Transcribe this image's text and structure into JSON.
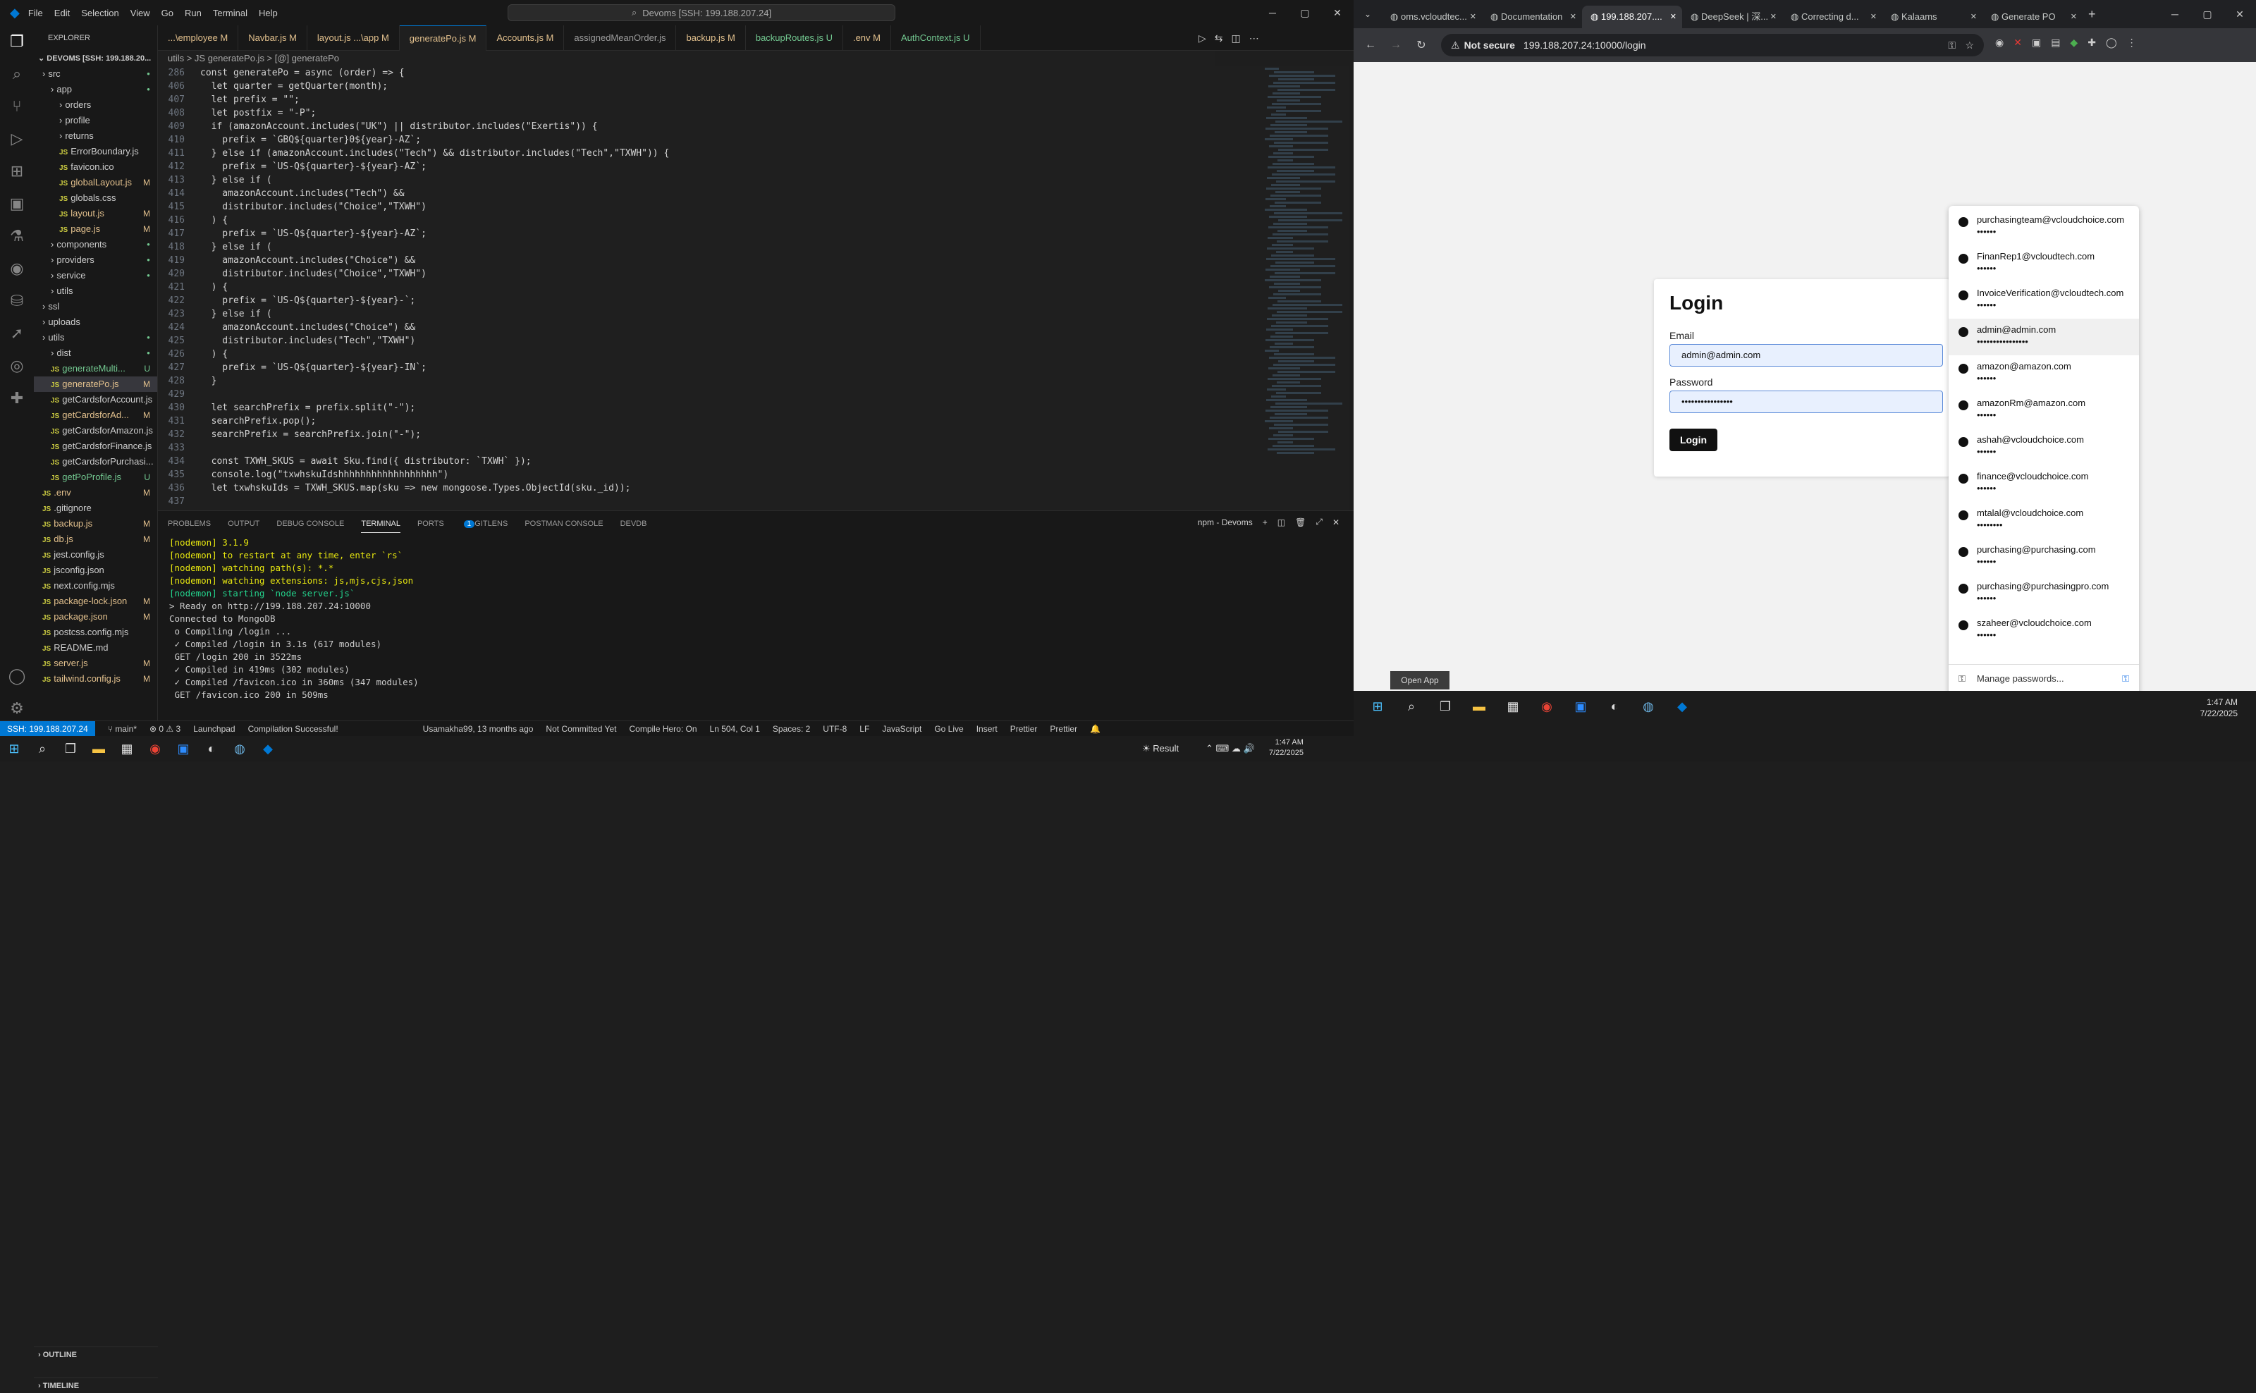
{
  "vscode": {
    "menu": [
      "File",
      "Edit",
      "Selection",
      "View",
      "Go",
      "Run",
      "Terminal",
      "Help"
    ],
    "command_center": "Devoms [SSH: 199.188.207.24]",
    "explorer_title": "EXPLORER",
    "explorer_root": "DEVOMS [SSH: 199.188.20...",
    "tree": [
      {
        "label": "src",
        "indent": 1,
        "status": "",
        "dot": true
      },
      {
        "label": "app",
        "indent": 2,
        "status": "",
        "dot": true
      },
      {
        "label": "orders",
        "indent": 3,
        "status": ""
      },
      {
        "label": "profile",
        "indent": 3,
        "status": ""
      },
      {
        "label": "returns",
        "indent": 3,
        "status": ""
      },
      {
        "label": "ErrorBoundary.js",
        "indent": 3,
        "status": ""
      },
      {
        "label": "favicon.ico",
        "indent": 3,
        "status": ""
      },
      {
        "label": "globalLayout.js",
        "indent": 3,
        "status": "M"
      },
      {
        "label": "globals.css",
        "indent": 3,
        "status": ""
      },
      {
        "label": "layout.js",
        "indent": 3,
        "status": "M"
      },
      {
        "label": "page.js",
        "indent": 3,
        "status": "M"
      },
      {
        "label": "components",
        "indent": 2,
        "status": "",
        "dot": true
      },
      {
        "label": "providers",
        "indent": 2,
        "status": "",
        "dot": true
      },
      {
        "label": "service",
        "indent": 2,
        "status": "",
        "dot": true
      },
      {
        "label": "utils",
        "indent": 2,
        "status": ""
      },
      {
        "label": "ssl",
        "indent": 1,
        "status": ""
      },
      {
        "label": "uploads",
        "indent": 1,
        "status": ""
      },
      {
        "label": "utils",
        "indent": 1,
        "status": "",
        "dot": true
      },
      {
        "label": "dist",
        "indent": 2,
        "status": "",
        "dot": true
      },
      {
        "label": "generateMulti...",
        "indent": 2,
        "status": "U"
      },
      {
        "label": "generatePo.js",
        "indent": 2,
        "status": "M",
        "selected": true
      },
      {
        "label": "getCardsforAccount.js",
        "indent": 2,
        "status": ""
      },
      {
        "label": "getCardsforAd...",
        "indent": 2,
        "status": "M"
      },
      {
        "label": "getCardsforAmazon.js",
        "indent": 2,
        "status": ""
      },
      {
        "label": "getCardsforFinance.js",
        "indent": 2,
        "status": ""
      },
      {
        "label": "getCardsforPurchasi...",
        "indent": 2,
        "status": ""
      },
      {
        "label": "getPoProfile.js",
        "indent": 2,
        "status": "U"
      },
      {
        "label": ".env",
        "indent": 1,
        "status": "M"
      },
      {
        "label": ".gitignore",
        "indent": 1,
        "status": ""
      },
      {
        "label": "backup.js",
        "indent": 1,
        "status": "M"
      },
      {
        "label": "db.js",
        "indent": 1,
        "status": "M"
      },
      {
        "label": "jest.config.js",
        "indent": 1,
        "status": ""
      },
      {
        "label": "jsconfig.json",
        "indent": 1,
        "status": ""
      },
      {
        "label": "next.config.mjs",
        "indent": 1,
        "status": ""
      },
      {
        "label": "package-lock.json",
        "indent": 1,
        "status": "M"
      },
      {
        "label": "package.json",
        "indent": 1,
        "status": "M"
      },
      {
        "label": "postcss.config.mjs",
        "indent": 1,
        "status": ""
      },
      {
        "label": "README.md",
        "indent": 1,
        "status": ""
      },
      {
        "label": "server.js",
        "indent": 1,
        "status": "M"
      },
      {
        "label": "tailwind.config.js",
        "indent": 1,
        "status": "M"
      }
    ],
    "outline": "OUTLINE",
    "timeline": "TIMELINE",
    "tabs": [
      {
        "label": "...\\employee M",
        "cls": "m"
      },
      {
        "label": "Navbar.js M",
        "cls": "m"
      },
      {
        "label": "layout.js ...\\app M",
        "cls": "m"
      },
      {
        "label": "generatePo.js M",
        "cls": "m",
        "active": true
      },
      {
        "label": "Accounts.js M",
        "cls": "m"
      },
      {
        "label": "assignedMeanOrder.js",
        "cls": ""
      },
      {
        "label": "backup.js M",
        "cls": "m"
      },
      {
        "label": "backupRoutes.js U",
        "cls": "u"
      },
      {
        "label": ".env M",
        "cls": "m"
      },
      {
        "label": "AuthContext.js U",
        "cls": "u"
      }
    ],
    "breadcrumb": "utils > JS generatePo.js > [@] generatePo",
    "code": [
      {
        "n": "286",
        "t": "const generatePo = async (order) => {"
      },
      {
        "n": "406",
        "t": "  let quarter = getQuarter(month);"
      },
      {
        "n": "407",
        "t": "  let prefix = \"\";"
      },
      {
        "n": "408",
        "t": "  let postfix = \"-P\";"
      },
      {
        "n": "409",
        "t": "  if (amazonAccount.includes(\"UK\") || distributor.includes(\"Exertis\")) {"
      },
      {
        "n": "410",
        "t": "    prefix = `GBQ${quarter}0${year}-AZ`;"
      },
      {
        "n": "411",
        "t": "  } else if (amazonAccount.includes(\"Tech\") && distributor.includes(\"Tech\",\"TXWH\")) {"
      },
      {
        "n": "412",
        "t": "    prefix = `US-Q${quarter}-${year}-AZ`;"
      },
      {
        "n": "413",
        "t": "  } else if ("
      },
      {
        "n": "414",
        "t": "    amazonAccount.includes(\"Tech\") &&"
      },
      {
        "n": "415",
        "t": "    distributor.includes(\"Choice\",\"TXWH\")"
      },
      {
        "n": "416",
        "t": "  ) {"
      },
      {
        "n": "417",
        "t": "    prefix = `US-Q${quarter}-${year}-AZ`;"
      },
      {
        "n": "418",
        "t": "  } else if ("
      },
      {
        "n": "419",
        "t": "    amazonAccount.includes(\"Choice\") &&"
      },
      {
        "n": "420",
        "t": "    distributor.includes(\"Choice\",\"TXWH\")"
      },
      {
        "n": "421",
        "t": "  ) {"
      },
      {
        "n": "422",
        "t": "    prefix = `US-Q${quarter}-${year}-`;"
      },
      {
        "n": "423",
        "t": "  } else if ("
      },
      {
        "n": "424",
        "t": "    amazonAccount.includes(\"Choice\") &&"
      },
      {
        "n": "425",
        "t": "    distributor.includes(\"Tech\",\"TXWH\")"
      },
      {
        "n": "426",
        "t": "  ) {"
      },
      {
        "n": "427",
        "t": "    prefix = `US-Q${quarter}-${year}-IN`;"
      },
      {
        "n": "428",
        "t": "  }"
      },
      {
        "n": "429",
        "t": ""
      },
      {
        "n": "430",
        "t": "  let searchPrefix = prefix.split(\"-\");"
      },
      {
        "n": "431",
        "t": "  searchPrefix.pop();"
      },
      {
        "n": "432",
        "t": "  searchPrefix = searchPrefix.join(\"-\");"
      },
      {
        "n": "433",
        "t": ""
      },
      {
        "n": "434",
        "t": "  const TXWH_SKUS = await Sku.find({ distributor: `TXWH` });"
      },
      {
        "n": "435",
        "t": "  console.log(\"txwhskuIdshhhhhhhhhhhhhhhhhh\")"
      },
      {
        "n": "436",
        "t": "  let txwhskuIds = TXWH_SKUS.map(sku => new mongoose.Types.ObjectId(sku._id));"
      },
      {
        "n": "437",
        "t": ""
      }
    ],
    "panel_tabs": [
      "PROBLEMS",
      "OUTPUT",
      "DEBUG CONSOLE",
      "TERMINAL",
      "PORTS",
      "GITLENS",
      "POSTMAN CONSOLE",
      "DEVDB"
    ],
    "ports_count": "1",
    "terminal_name": "npm - Devoms",
    "terminal": [
      {
        "t": "[nodemon] 3.1.9",
        "c": "yellow"
      },
      {
        "t": "[nodemon] to restart at any time, enter `rs`",
        "c": "yellow"
      },
      {
        "t": "[nodemon] watching path(s): *.*",
        "c": "yellow"
      },
      {
        "t": "[nodemon] watching extensions: js,mjs,cjs,json",
        "c": "yellow"
      },
      {
        "t": "[nodemon] starting `node server.js`",
        "c": "green"
      },
      {
        "t": "> Ready on http://199.188.207.24:10000",
        "c": "white"
      },
      {
        "t": "Connected to MongoDB",
        "c": "white"
      },
      {
        "t": " o Compiling /login ...",
        "c": "white"
      },
      {
        "t": " ✓ Compiled /login in 3.1s (617 modules)",
        "c": "white"
      },
      {
        "t": " GET /login 200 in 3522ms",
        "c": "white"
      },
      {
        "t": " ✓ Compiled in 419ms (302 modules)",
        "c": "white"
      },
      {
        "t": " ✓ Compiled /favicon.ico in 360ms (347 modules)",
        "c": "white"
      },
      {
        "t": " GET /favicon.ico 200 in 509ms",
        "c": "white"
      }
    ],
    "status": {
      "remote": "SSH: 199.188.207.24",
      "branch": "main*",
      "errors": "0",
      "warnings": "3",
      "launchpad": "Launchpad",
      "compile": "Compilation Successful!",
      "blame": "Usamakha99, 13 months ago",
      "commit": "Not Committed Yet",
      "compile_hero": "Compile Hero: On",
      "position": "Ln 504, Col 1",
      "spaces": "Spaces: 2",
      "encoding": "UTF-8",
      "eol": "LF",
      "language": "JavaScript",
      "golive": "Go Live",
      "insert": "Insert",
      "prettier1": "Prettier",
      "prettier2": "Prettier"
    }
  },
  "chrome": {
    "tabs": [
      "oms.vcloudtec...",
      "Documentation",
      "199.188.207....",
      "DeepSeek | 深...",
      "Correcting d...",
      "Kalaams",
      "Generate PO"
    ],
    "active_tab": 2,
    "not_secure": "Not secure",
    "url": "199.188.207.24:10000/login",
    "login": {
      "title": "Login",
      "email_label": "Email",
      "email_value": "admin@admin.com",
      "password_label": "Password",
      "password_value": "••••••••••••••••",
      "button": "Login"
    },
    "passwords": [
      {
        "user": "purchasingteam@vcloudchoice.com",
        "dots": "••••••"
      },
      {
        "user": "FinanRep1@vcloudtech.com",
        "dots": "••••••"
      },
      {
        "user": "InvoiceVerification@vcloudtech.com",
        "dots": "••••••"
      },
      {
        "user": "admin@admin.com",
        "dots": "••••••••••••••••",
        "hl": true
      },
      {
        "user": "amazon@amazon.com",
        "dots": "••••••"
      },
      {
        "user": "amazonRm@amazon.com",
        "dots": "••••••"
      },
      {
        "user": "ashah@vcloudchoice.com",
        "dots": "••••••"
      },
      {
        "user": "finance@vcloudchoice.com",
        "dots": "••••••"
      },
      {
        "user": "mtalal@vcloudchoice.com",
        "dots": "••••••••"
      },
      {
        "user": "purchasing@purchasing.com",
        "dots": "••••••"
      },
      {
        "user": "purchasing@purchasingpro.com",
        "dots": "••••••"
      },
      {
        "user": "szaheer@vcloudchoice.com",
        "dots": "••••••"
      }
    ],
    "manage_passwords": "Manage passwords...",
    "open_app": "Open App"
  },
  "taskbar": {
    "weather": "Result",
    "time": "1:47 AM",
    "date": "7/22/2025",
    "time_r": "1:47 AM",
    "date_r": "7/22/2025"
  }
}
